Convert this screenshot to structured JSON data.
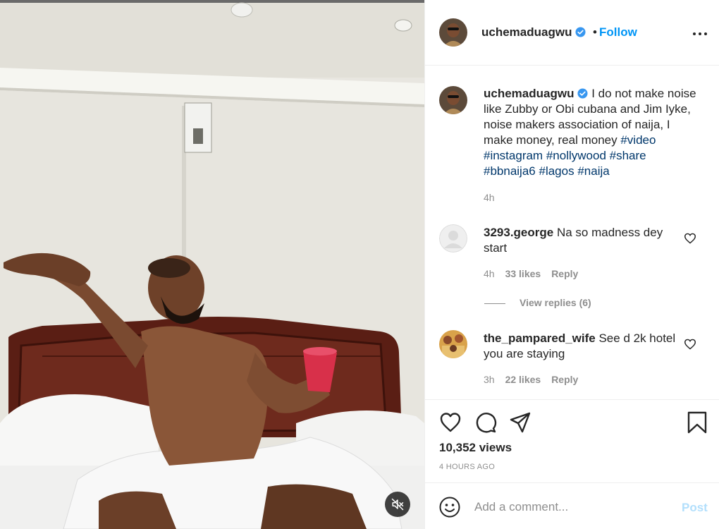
{
  "post": {
    "username": "uchemaduagwu",
    "dot": "•",
    "follow_label": "Follow",
    "more_icon": "more-options-icon"
  },
  "caption": {
    "username": "uchemaduagwu",
    "text": "I do not make noise like Zubby or Obi cubana and Jim Iyke, noise makers association of naija, I make money, real money",
    "hashtags": [
      "#video",
      "#instagram",
      "#nollywood",
      "#share",
      "#bbnaija6",
      "#lagos",
      "#naija"
    ],
    "time": "4h"
  },
  "comments": [
    {
      "username": "3293.george",
      "text": "Na so madness dey start",
      "time": "4h",
      "likes": "33 likes",
      "reply_label": "Reply",
      "view_replies": "View replies (6)"
    },
    {
      "username": "the_pampared_wife",
      "text": "See d 2k hotel you are staying",
      "time": "3h",
      "likes": "22 likes",
      "reply_label": "Reply"
    }
  ],
  "stats": {
    "views": "10,352 views",
    "time_ago": "4 HOURS AGO"
  },
  "composer": {
    "placeholder": "Add a comment...",
    "post_label": "Post"
  },
  "colors": {
    "accent": "#0095f6",
    "hashtag": "#00376b",
    "muted": "#8e8e8e",
    "verified": "#3897f0",
    "post_disabled": "#b2dffc"
  },
  "icons": [
    "verified-badge-icon",
    "heart-icon",
    "comment-icon",
    "share-icon",
    "bookmark-icon",
    "emoji-icon",
    "mute-icon"
  ]
}
